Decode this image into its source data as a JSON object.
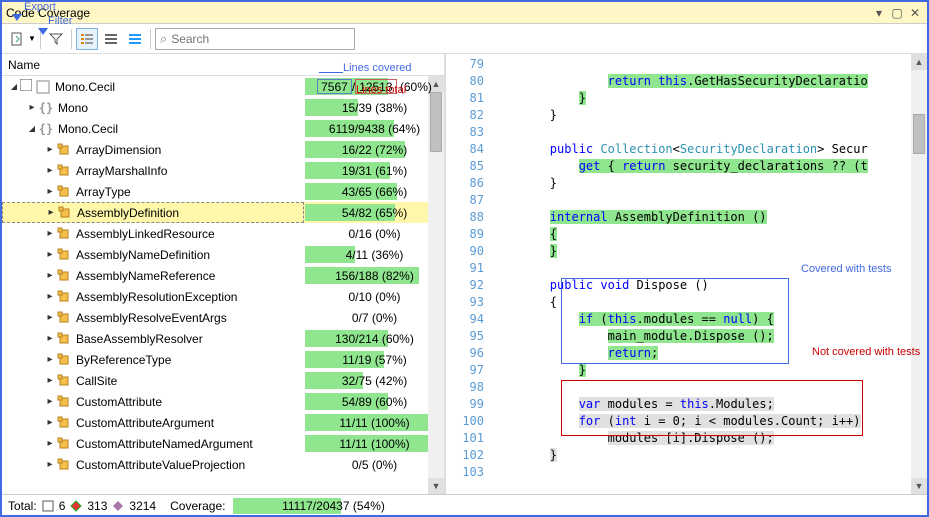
{
  "callouts": {
    "export": "Export",
    "filter": "Filter",
    "lines_covered": "Lines covered",
    "lines_total": "Lines total",
    "covered_tests": "Covered with tests",
    "not_covered": "Not covered with tests"
  },
  "title": "Code Coverage",
  "search_placeholder": "Search",
  "tree_header": "Name",
  "tree": [
    {
      "indent": 0,
      "exp": "open",
      "check": true,
      "icon": "neutral",
      "name": "Mono.Cecil",
      "cov": "7567/12513 (60%)",
      "pct": 60,
      "hdr": true
    },
    {
      "indent": 1,
      "exp": "closed",
      "icon": "ns",
      "name": "Mono",
      "cov": "15/39 (38%)",
      "pct": 38
    },
    {
      "indent": 1,
      "exp": "open",
      "icon": "ns",
      "name": "Mono.Cecil",
      "cov": "6119/9438 (64%)",
      "pct": 64
    },
    {
      "indent": 2,
      "exp": "closed",
      "icon": "class",
      "name": "ArrayDimension",
      "cov": "16/22 (72%)",
      "pct": 72
    },
    {
      "indent": 2,
      "exp": "closed",
      "icon": "class",
      "name": "ArrayMarshalInfo",
      "cov": "19/31 (61%)",
      "pct": 61
    },
    {
      "indent": 2,
      "exp": "closed",
      "icon": "class",
      "name": "ArrayType",
      "cov": "43/65 (66%)",
      "pct": 66
    },
    {
      "indent": 2,
      "exp": "closed",
      "icon": "class",
      "name": "AssemblyDefinition",
      "cov": "54/82 (65%)",
      "pct": 65,
      "sel": true
    },
    {
      "indent": 2,
      "exp": "closed",
      "icon": "class",
      "name": "AssemblyLinkedResource",
      "cov": "0/16 (0%)",
      "pct": 0
    },
    {
      "indent": 2,
      "exp": "closed",
      "icon": "class",
      "name": "AssemblyNameDefinition",
      "cov": "4/11 (36%)",
      "pct": 36
    },
    {
      "indent": 2,
      "exp": "closed",
      "icon": "class",
      "name": "AssemblyNameReference",
      "cov": "156/188 (82%)",
      "pct": 82
    },
    {
      "indent": 2,
      "exp": "closed",
      "icon": "class",
      "name": "AssemblyResolutionException",
      "cov": "0/10 (0%)",
      "pct": 0
    },
    {
      "indent": 2,
      "exp": "closed",
      "icon": "class",
      "name": "AssemblyResolveEventArgs",
      "cov": "0/7 (0%)",
      "pct": 0
    },
    {
      "indent": 2,
      "exp": "closed",
      "icon": "class",
      "name": "BaseAssemblyResolver",
      "cov": "130/214 (60%)",
      "pct": 60
    },
    {
      "indent": 2,
      "exp": "closed",
      "icon": "class",
      "name": "ByReferenceType",
      "cov": "11/19 (57%)",
      "pct": 57
    },
    {
      "indent": 2,
      "exp": "closed",
      "icon": "class",
      "name": "CallSite",
      "cov": "32/75 (42%)",
      "pct": 42
    },
    {
      "indent": 2,
      "exp": "closed",
      "icon": "class",
      "name": "CustomAttribute",
      "cov": "54/89 (60%)",
      "pct": 60
    },
    {
      "indent": 2,
      "exp": "closed",
      "icon": "class",
      "name": "CustomAttributeArgument",
      "cov": "11/11 (100%)",
      "pct": 100
    },
    {
      "indent": 2,
      "exp": "closed",
      "icon": "class",
      "name": "CustomAttributeNamedArgument",
      "cov": "11/11 (100%)",
      "pct": 100
    },
    {
      "indent": 2,
      "exp": "closed",
      "icon": "class",
      "name": "CustomAttributeValueProjection",
      "cov": "0/5 (0%)",
      "pct": 0
    }
  ],
  "code_start": 79,
  "code_lines": 25,
  "status": {
    "total_label": "Total:",
    "projects": "6",
    "fn": "313",
    "mod": "3214",
    "cov_label": "Coverage:",
    "cov_text": "11117/20437 (54%)",
    "cov_pct": 54
  }
}
